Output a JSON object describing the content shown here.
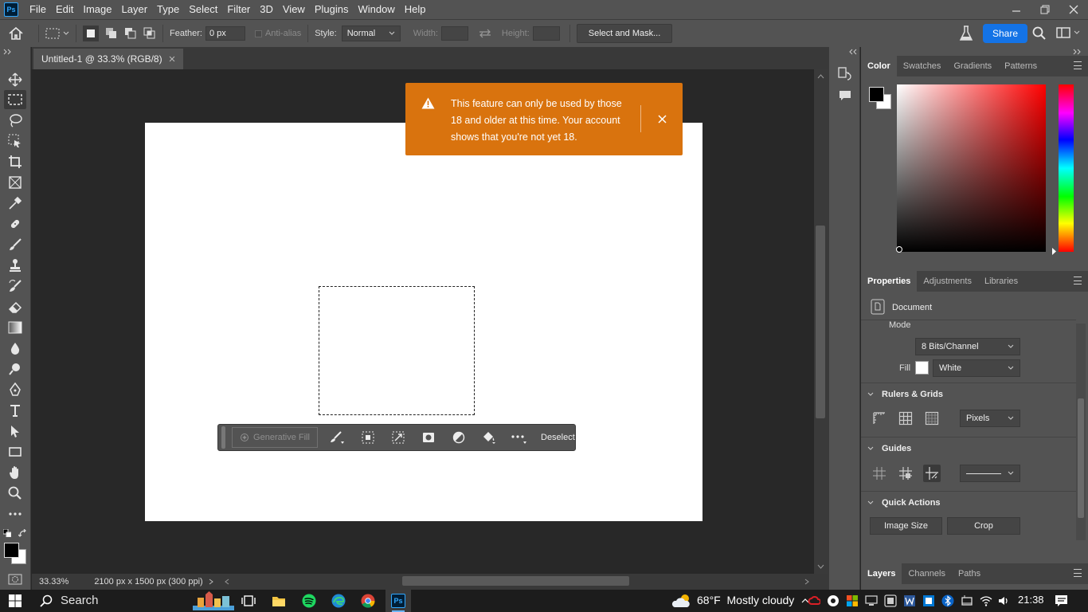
{
  "app": {
    "logo_text": "Ps",
    "menu": [
      "File",
      "Edit",
      "Image",
      "Layer",
      "Type",
      "Select",
      "Filter",
      "3D",
      "View",
      "Plugins",
      "Window",
      "Help"
    ]
  },
  "options_bar": {
    "feather_label": "Feather:",
    "feather_value": "0 px",
    "antialias_label": "Anti-alias",
    "style_label": "Style:",
    "style_value": "Normal",
    "width_label": "Width:",
    "height_label": "Height:",
    "select_mask_label": "Select and Mask...",
    "share_label": "Share"
  },
  "document": {
    "tab_title": "Untitled-1 @ 33.3% (RGB/8)",
    "zoom": "33.33%",
    "info": "2100 px x 1500 px (300 ppi)"
  },
  "alert": {
    "message": "This feature can only be used by those 18 and older at this time. Your account shows that you're not yet 18.",
    "color": "#d9730e"
  },
  "context_bar": {
    "generative_fill": "Generative Fill",
    "deselect": "Deselect"
  },
  "color_panel": {
    "tabs": [
      "Color",
      "Swatches",
      "Gradients",
      "Patterns"
    ],
    "hue": "#ff0000"
  },
  "properties_panel": {
    "tabs": [
      "Properties",
      "Adjustments",
      "Libraries"
    ],
    "doc_label": "Document",
    "mode_label": "Mode",
    "mode_value": "8 Bits/Channel",
    "fill_label": "Fill",
    "fill_value": "White",
    "rulers_label": "Rulers & Grids",
    "units_value": "Pixels",
    "guides_label": "Guides",
    "quick_actions_label": "Quick Actions",
    "image_size_label": "Image Size",
    "crop_label": "Crop"
  },
  "layers_panel": {
    "tabs": [
      "Layers",
      "Channels",
      "Paths"
    ]
  },
  "windows_taskbar": {
    "search_label": "Search",
    "weather": "68°F  Mostly cloudy",
    "time": "21:38"
  }
}
